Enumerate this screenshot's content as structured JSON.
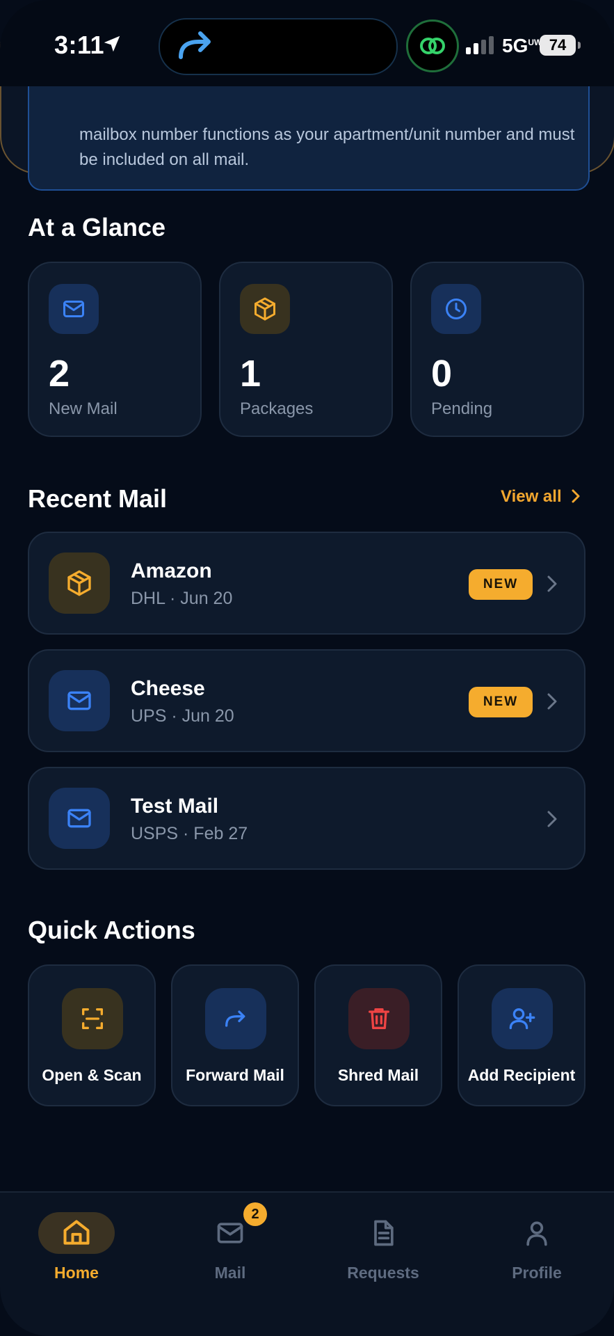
{
  "status_bar": {
    "time": "3:11",
    "network": "5G",
    "network_sub": "UW",
    "battery": "74"
  },
  "notice": {
    "text": "mailbox number functions as your apartment/unit number and must be included on all mail."
  },
  "at_a_glance": {
    "title": "At a Glance",
    "cards": [
      {
        "value": "2",
        "label": "New Mail",
        "icon": "mail-icon",
        "color": "#3b82f6"
      },
      {
        "value": "1",
        "label": "Packages",
        "icon": "package-icon",
        "color": "#f5ac2e"
      },
      {
        "value": "0",
        "label": "Pending",
        "icon": "clock-icon",
        "color": "#3b82f6"
      }
    ]
  },
  "recent_mail": {
    "title": "Recent Mail",
    "view_all": "View all",
    "items": [
      {
        "title": "Amazon",
        "subtitle": "DHL · Jun 20",
        "badge": "NEW",
        "icon": "package-icon"
      },
      {
        "title": "Cheese",
        "subtitle": "UPS · Jun 20",
        "badge": "NEW",
        "icon": "mail-icon"
      },
      {
        "title": "Test Mail",
        "subtitle": "USPS · Feb 27",
        "badge": "",
        "icon": "mail-icon"
      }
    ]
  },
  "quick_actions": {
    "title": "Quick Actions",
    "items": [
      {
        "label": "Open & Scan",
        "icon": "scan-icon"
      },
      {
        "label": "Forward Mail",
        "icon": "forward-icon"
      },
      {
        "label": "Shred Mail",
        "icon": "trash-icon"
      },
      {
        "label": "Add Recipient",
        "icon": "add-user-icon"
      }
    ]
  },
  "bottom_nav": {
    "items": [
      {
        "label": "Home",
        "icon": "home-icon",
        "active": true
      },
      {
        "label": "Mail",
        "icon": "mail-icon",
        "badge": "2"
      },
      {
        "label": "Requests",
        "icon": "document-icon"
      },
      {
        "label": "Profile",
        "icon": "user-icon"
      }
    ]
  },
  "colors": {
    "accent": "#f5ac2e",
    "blue": "#3b82f6",
    "red": "#ef4444",
    "background": "#050c19",
    "card": "#0e1a2c"
  }
}
